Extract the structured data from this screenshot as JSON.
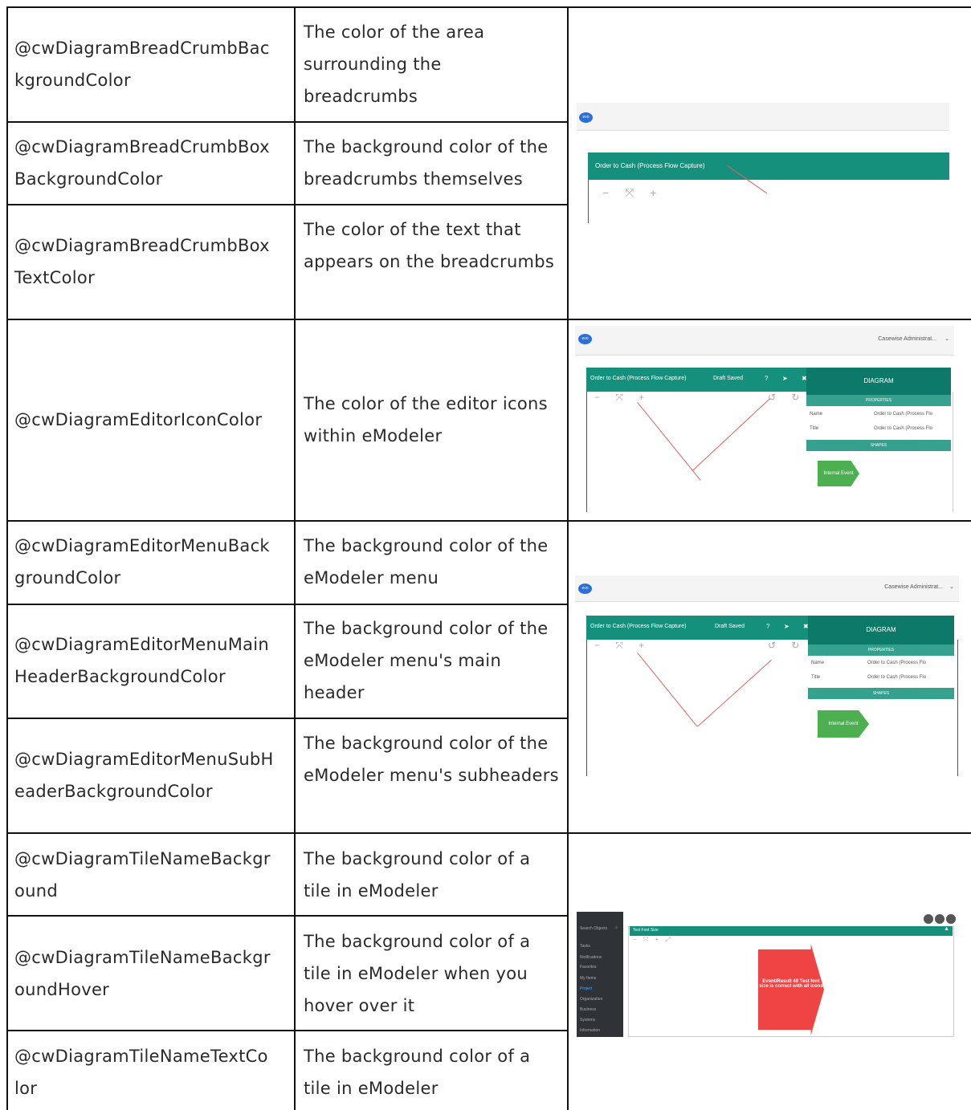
{
  "rows": [
    {
      "variable": "@cwDiagramBreadCrumbBac kgroundColor",
      "description": "The color of the area surrounding the breadcrumbs"
    },
    {
      "variable": "@cwDiagramBreadCrumbBox BackgroundColor",
      "description": "The background color of the breadcrumbs themselves"
    },
    {
      "variable": "@cwDiagramBreadCrumbBox TextColor",
      "description": "The color of the text that appears on the breadcrumbs"
    },
    {
      "variable": "@cwDiagramEditorIconColor",
      "description": "The color of the editor icons within eModeler"
    },
    {
      "variable": "@cwDiagramEditorMenuBack groundColor",
      "description": "The background color of the eModeler menu"
    },
    {
      "variable": "@cwDiagramEditorMenuMain HeaderBackgroundColor",
      "description": "The background color of the eModeler menu's main header"
    },
    {
      "variable": "@cwDiagramEditorMenuSubH eaderBackgroundColor",
      "description": "The background color of the eModeler menu's subheaders"
    },
    {
      "variable": "@cwDiagramTileNameBackgr ound",
      "description": "The background color of a tile in eModeler"
    },
    {
      "variable": "@cwDiagramTileNameBackgr oundHover",
      "description": "The background color of a tile in eModeler when you hover over it"
    },
    {
      "variable": "@cwDiagramTileNameTextCo lor",
      "description": "The background color of a tile in eModeler"
    }
  ],
  "screenshots": {
    "logo_text": "evo",
    "breadcrumb": "Order to Cash (Process Flow Capture)",
    "user_menu": "Casewise Administrat...",
    "draft_saved": "Draft Saved",
    "panel_title": "DIAGRAM",
    "properties_header": "PROPERTIES",
    "shapes_header": "SHAPES",
    "prop_name_label": "Name",
    "prop_name_value": "Order to Cash (Process Flo",
    "prop_title_label": "Title",
    "prop_title_value": "Order to Cash (Process Flo",
    "shape_label": "Internal Event",
    "tile_tab": "Test Font Size",
    "tile_text": "Event/Result 49 Test font size is correct with all icons",
    "search_placeholder": "Search Objects",
    "side_items": [
      "Tasks",
      "Notifications",
      "Favorites",
      "My Items",
      "Project",
      "Organization",
      "Business",
      "Systems",
      "Information"
    ]
  },
  "colors": {
    "teal": "#14907c",
    "accent_red": "#ef4444",
    "shape_green": "#4caf50"
  }
}
